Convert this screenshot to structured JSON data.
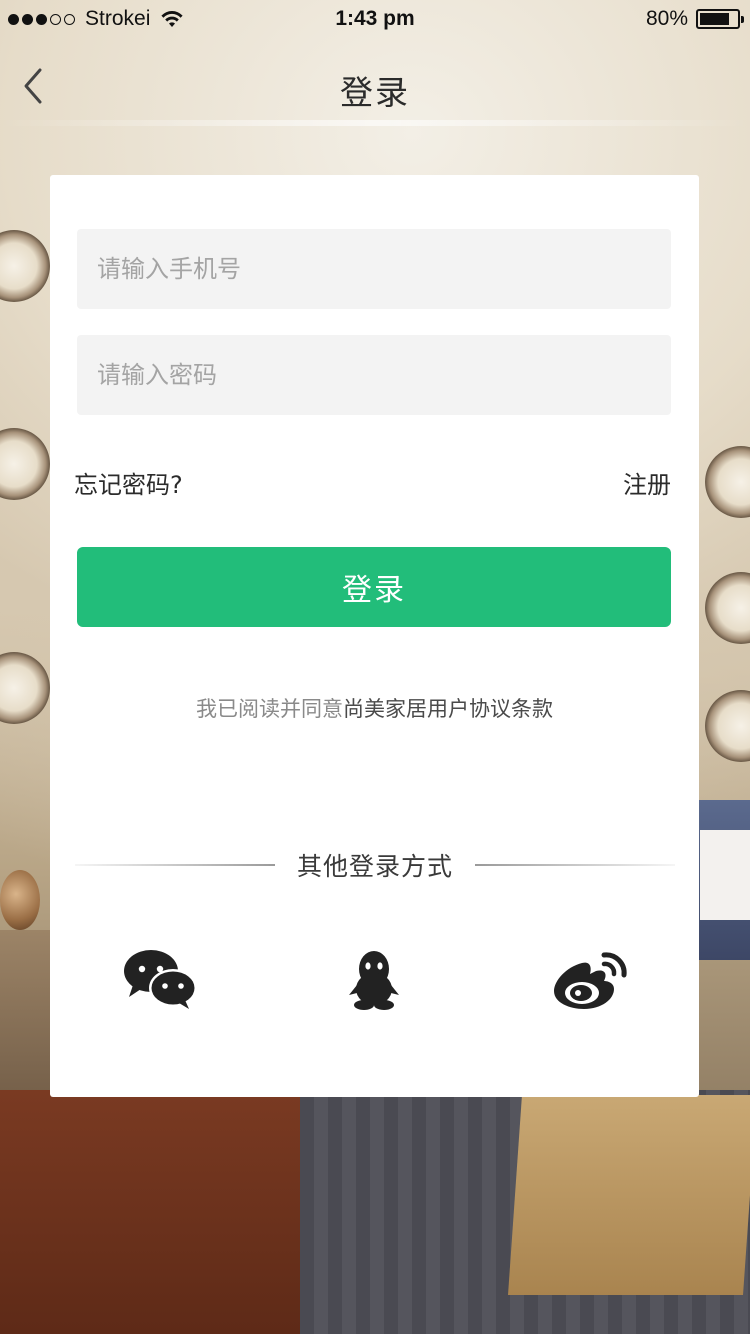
{
  "status_bar": {
    "carrier": "Strokei",
    "time": "1:43 pm",
    "battery_percent": "80%",
    "battery_level": 0.8,
    "signal_icon": "signal-dots-icon",
    "wifi_icon": "wifi-icon",
    "battery_icon": "battery-icon"
  },
  "nav": {
    "title": "登录",
    "back_icon": "chevron-left-icon"
  },
  "form": {
    "phone_placeholder": "请输入手机号",
    "phone_value": "",
    "password_placeholder": "请输入密码",
    "password_value": "",
    "forgot_label": "忘记密码?",
    "register_label": "注册",
    "login_label": "登录"
  },
  "agreement": {
    "prefix": "我已阅读并同意",
    "link": "尚美家居用户协议条款"
  },
  "other_login": {
    "label": "其他登录方式",
    "providers": [
      {
        "name": "wechat",
        "icon": "wechat-icon"
      },
      {
        "name": "qq",
        "icon": "qq-icon"
      },
      {
        "name": "weibo",
        "icon": "weibo-icon"
      }
    ]
  },
  "colors": {
    "accent": "#22bd7a",
    "field_bg": "#f3f3f3",
    "icon_dark": "#222222"
  }
}
